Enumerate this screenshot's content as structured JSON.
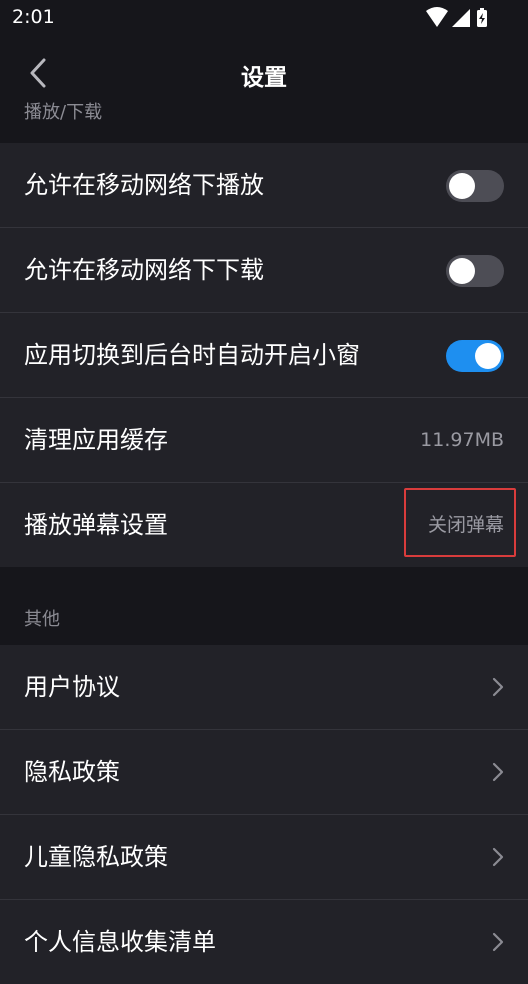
{
  "status_bar": {
    "time": "2:01"
  },
  "header": {
    "title": "设置"
  },
  "sections": {
    "playback_label": "播放/下载",
    "other_label": "其他"
  },
  "playback": {
    "mobile_play_label": "允许在移动网络下播放",
    "mobile_play_on": false,
    "mobile_download_label": "允许在移动网络下下载",
    "mobile_download_on": false,
    "pip_label": "应用切换到后台时自动开启小窗",
    "pip_on": true,
    "cache_label": "清理应用缓存",
    "cache_size": "11.97MB",
    "danmaku_label": "播放弹幕设置",
    "danmaku_value": "关闭弹幕"
  },
  "other": {
    "items": [
      "用户协议",
      "隐私政策",
      "儿童隐私政策",
      "个人信息收集清单"
    ]
  },
  "colors": {
    "background": "#16161b",
    "card": "#222228",
    "toggle_on": "#1e8ff0",
    "toggle_off": "#4d4d55",
    "highlight": "#d93c3c"
  }
}
